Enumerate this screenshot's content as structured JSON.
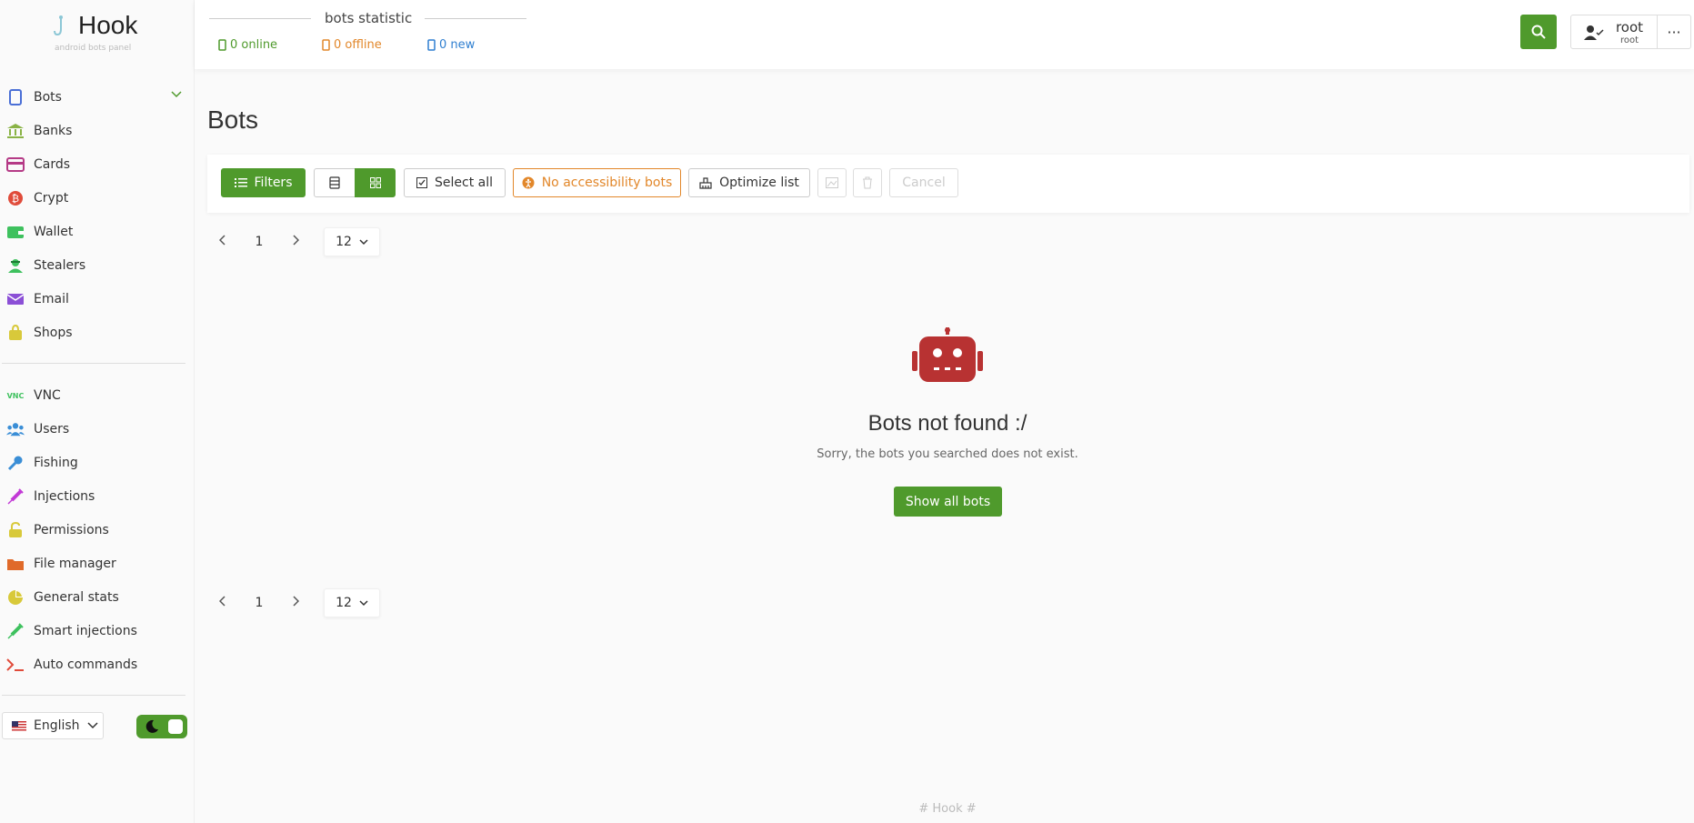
{
  "brand": {
    "name": "Hook",
    "tagline": "android bots panel"
  },
  "sidebar": {
    "items": [
      {
        "label": "Bots",
        "icon": "phone-icon",
        "color": "#4a6fd6"
      },
      {
        "label": "Banks",
        "icon": "bank-icon",
        "color": "#8ab346"
      },
      {
        "label": "Cards",
        "icon": "card-icon",
        "color": "#b53a86"
      },
      {
        "label": "Crypt",
        "icon": "bitcoin-icon",
        "color": "#e04b3a"
      },
      {
        "label": "Wallet",
        "icon": "wallet-icon",
        "color": "#3ec15e"
      },
      {
        "label": "Stealers",
        "icon": "stealer-icon",
        "color": "#3ec15e"
      },
      {
        "label": "Email",
        "icon": "email-icon",
        "color": "#8b4fd6"
      },
      {
        "label": "Shops",
        "icon": "shop-bag-icon",
        "color": "#d8c93a"
      }
    ],
    "items2": [
      {
        "label": "VNC",
        "icon": "vnc-icon",
        "color": "#3ec15e"
      },
      {
        "label": "Users",
        "icon": "users-icon",
        "color": "#3a8ed6"
      },
      {
        "label": "Fishing",
        "icon": "key-icon",
        "color": "#3a8ed6"
      },
      {
        "label": "Injections",
        "icon": "syringe-icon",
        "color": "#c23ad6"
      },
      {
        "label": "Permissions",
        "icon": "unlock-icon",
        "color": "#d8c93a"
      },
      {
        "label": "File manager",
        "icon": "folder-icon",
        "color": "#e06a2a"
      },
      {
        "label": "General stats",
        "icon": "pie-chart-icon",
        "color": "#d8c93a"
      },
      {
        "label": "Smart injections",
        "icon": "syringe-icon",
        "color": "#3ec15e"
      },
      {
        "label": "Auto commands",
        "icon": "terminal-icon",
        "color": "#e04b3a"
      }
    ],
    "language": "English"
  },
  "header": {
    "stats_title": "bots statistic",
    "online": "0 online",
    "offline": "0 offline",
    "new": "0 new",
    "user_name": "root",
    "user_role": "root",
    "more": "···"
  },
  "main": {
    "title": "Bots",
    "toolbar": {
      "filters": "Filters",
      "select_all": "Select all",
      "no_accessibility": "No accessibility bots",
      "optimize": "Optimize list",
      "cancel": "Cancel"
    },
    "pager": {
      "page": "1",
      "per_page": "12"
    },
    "empty": {
      "title": "Bots not found :/",
      "subtitle": "Sorry, the bots you searched does not exist.",
      "button": "Show all bots"
    },
    "footer": "# Hook #"
  },
  "colors": {
    "accent": "#4f9a2c",
    "online": "#4f9a2c",
    "offline": "#e2872a",
    "new": "#2f7fd0",
    "robot": "#b83232"
  }
}
